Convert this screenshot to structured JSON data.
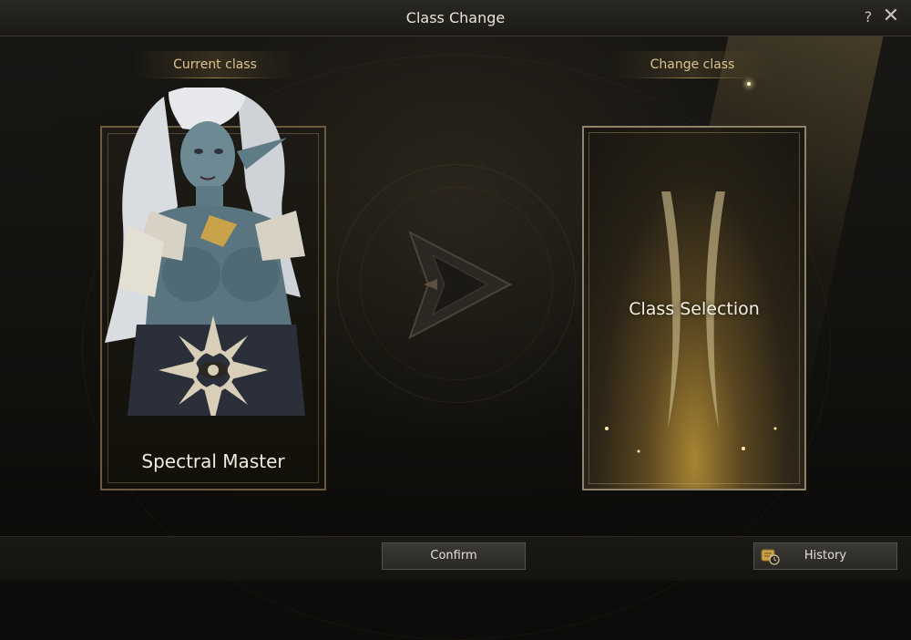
{
  "window": {
    "title": "Class Change",
    "help_label": "?",
    "close_label": "✕"
  },
  "current": {
    "section_label": "Current class",
    "class_name": "Spectral Master"
  },
  "change": {
    "section_label": "Change class",
    "placeholder": "Class Selection"
  },
  "footer": {
    "confirm_label": "Confirm",
    "history_label": "History"
  },
  "icons": {
    "help": "help-icon",
    "close": "close-icon",
    "arrow": "arrow-right-icon",
    "history": "history-scroll-icon",
    "class_emblem": "eye-star-emblem-icon"
  },
  "colors": {
    "accent_gold": "#d9c48e",
    "frame_bronze": "#6b5a3d",
    "select_glow": "#d2a53c"
  }
}
